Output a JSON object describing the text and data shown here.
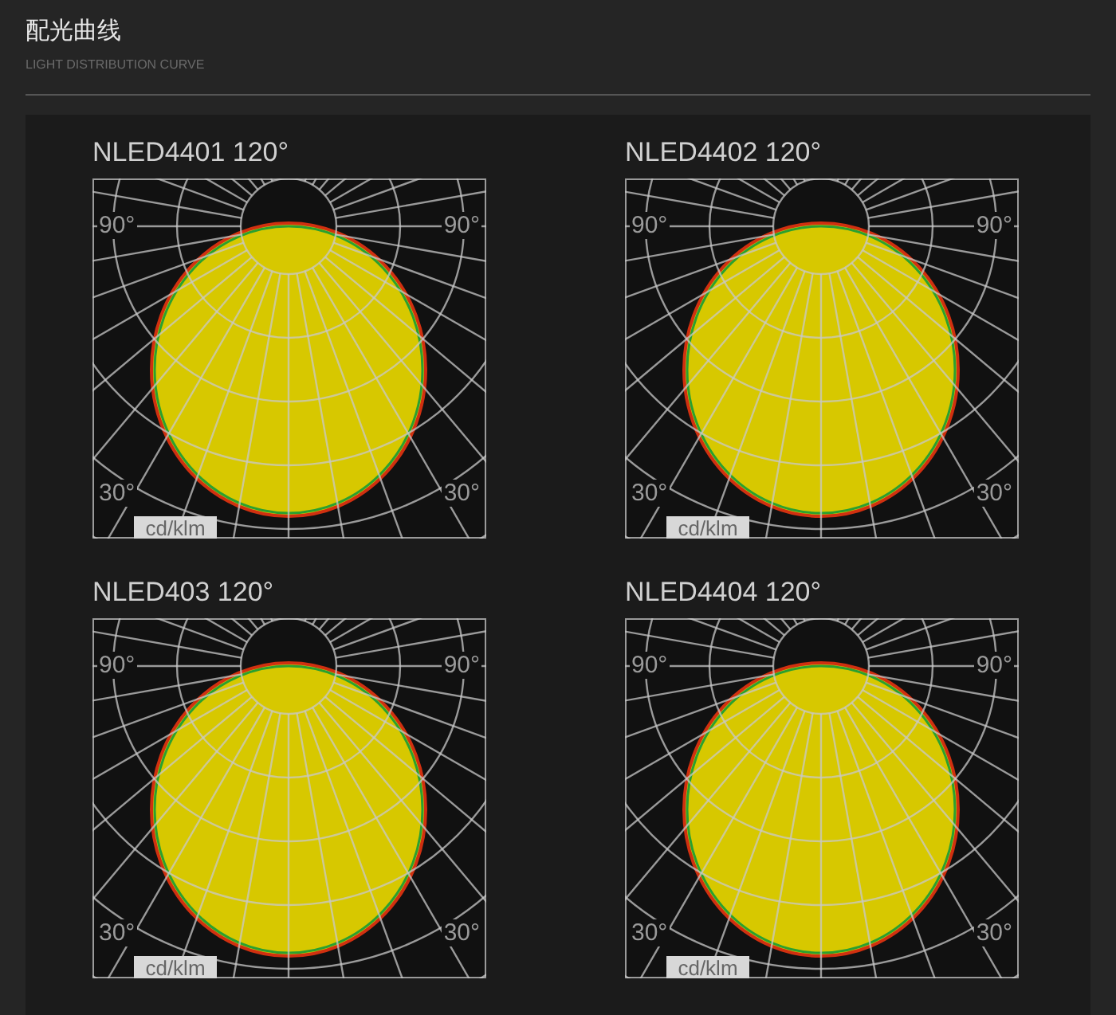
{
  "header": {
    "title": "配光曲线",
    "subtitle": "LIGHT DISTRIBUTION CURVE"
  },
  "curves": [
    {
      "model": "NLED4401",
      "beam": "120°",
      "scale_labels": [
        "90°",
        "90°",
        "30°",
        "30°"
      ],
      "unit": "cd/klm"
    },
    {
      "model": "NLED4402",
      "beam": "120°",
      "scale_labels": [
        "90°",
        "90°",
        "30°",
        "30°"
      ],
      "unit": "cd/klm"
    },
    {
      "model": "NLED403",
      "beam": "120°",
      "scale_labels": [
        "90°",
        "90°",
        "30°",
        "30°"
      ],
      "unit": "cd/klm"
    },
    {
      "model": "NLED4404",
      "beam": "120°",
      "scale_labels": [
        "90°",
        "90°",
        "30°",
        "30°"
      ],
      "unit": "cd/klm"
    }
  ]
}
